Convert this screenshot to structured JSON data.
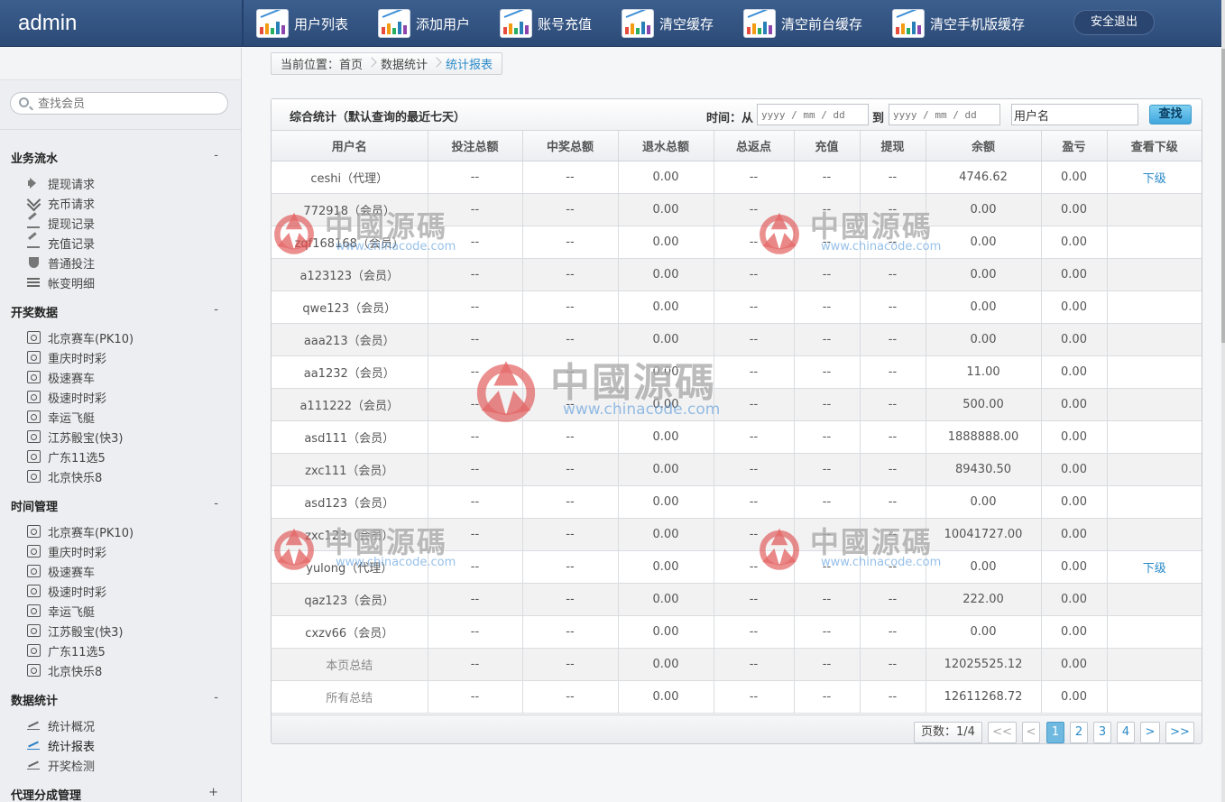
{
  "app": {
    "title": "admin"
  },
  "top_nav": [
    {
      "label": "用户列表",
      "icon": "chart-icon"
    },
    {
      "label": "添加用户",
      "icon": "chart-icon"
    },
    {
      "label": "账号充值",
      "icon": "chart-icon"
    },
    {
      "label": "清空缓存",
      "icon": "chart-icon"
    },
    {
      "label": "清空前台缓存",
      "icon": "chart-icon"
    },
    {
      "label": "清空手机版缓存",
      "icon": "chart-icon"
    }
  ],
  "logout_label": "安全退出",
  "sidebar": {
    "search_placeholder": "查找会员",
    "groups": [
      {
        "title": "业务流水",
        "toggle": "-",
        "items": [
          {
            "label": "提现请求",
            "icon": "speaker-icon"
          },
          {
            "label": "充币请求",
            "icon": "double-chevron-icon"
          },
          {
            "label": "提现记录",
            "icon": "pencil-icon"
          },
          {
            "label": "充值记录",
            "icon": "pencil-icon"
          },
          {
            "label": "普通投注",
            "icon": "shield-icon"
          },
          {
            "label": "帐变明细",
            "icon": "list-icon"
          }
        ]
      },
      {
        "title": "开奖数据",
        "toggle": "-",
        "items": [
          {
            "label": "北京赛车(PK10)",
            "icon": "target-icon"
          },
          {
            "label": "重庆时时彩",
            "icon": "target-icon"
          },
          {
            "label": "极速赛车",
            "icon": "target-icon"
          },
          {
            "label": "极速时时彩",
            "icon": "target-icon"
          },
          {
            "label": "幸运飞艇",
            "icon": "target-icon"
          },
          {
            "label": "江苏骰宝(快3)",
            "icon": "target-icon"
          },
          {
            "label": "广东11选5",
            "icon": "target-icon"
          },
          {
            "label": "北京快乐8",
            "icon": "target-icon"
          }
        ]
      },
      {
        "title": "时间管理",
        "toggle": "-",
        "items": [
          {
            "label": "北京赛车(PK10)",
            "icon": "target-icon"
          },
          {
            "label": "重庆时时彩",
            "icon": "target-icon"
          },
          {
            "label": "极速赛车",
            "icon": "target-icon"
          },
          {
            "label": "极速时时彩",
            "icon": "target-icon"
          },
          {
            "label": "幸运飞艇",
            "icon": "target-icon"
          },
          {
            "label": "江苏骰宝(快3)",
            "icon": "target-icon"
          },
          {
            "label": "广东11选5",
            "icon": "target-icon"
          },
          {
            "label": "北京快乐8",
            "icon": "target-icon"
          }
        ]
      },
      {
        "title": "数据统计",
        "toggle": "-",
        "items": [
          {
            "label": "统计概况",
            "icon": "line-chart-icon"
          },
          {
            "label": "统计报表",
            "icon": "line-chart-icon",
            "active": true
          },
          {
            "label": "开奖检测",
            "icon": "line-chart-icon"
          }
        ]
      },
      {
        "title": "代理分成管理",
        "toggle": "+",
        "items": []
      }
    ]
  },
  "breadcrumb": [
    "当前位置：首页",
    "数据统计",
    "统计报表"
  ],
  "panel": {
    "title": "综合统计（默认查询的最近七天）",
    "time_label": "时间：从",
    "to_label": "到",
    "date_placeholder": "yyyy / mm / dd",
    "date_from": "",
    "date_to": "",
    "username_value": "用户名",
    "search_label": "查找"
  },
  "table": {
    "columns": [
      "用户名",
      "投注总额",
      "中奖总额",
      "退水总额",
      "总返点",
      "充值",
      "提现",
      "余额",
      "盈亏",
      "查看下级"
    ],
    "rows": [
      [
        "ceshi（代理）",
        "--",
        "--",
        "0.00",
        "--",
        "--",
        "--",
        "4746.62",
        "0.00",
        "下级"
      ],
      [
        "772918（会员）",
        "--",
        "--",
        "0.00",
        "--",
        "--",
        "--",
        "0.00",
        "0.00",
        ""
      ],
      [
        "zqf168168（会员）",
        "--",
        "--",
        "0.00",
        "--",
        "--",
        "--",
        "0.00",
        "0.00",
        ""
      ],
      [
        "a123123（会员）",
        "--",
        "--",
        "0.00",
        "--",
        "--",
        "--",
        "0.00",
        "0.00",
        ""
      ],
      [
        "qwe123（会员）",
        "--",
        "--",
        "0.00",
        "--",
        "--",
        "--",
        "0.00",
        "0.00",
        ""
      ],
      [
        "aaa213（会员）",
        "--",
        "--",
        "0.00",
        "--",
        "--",
        "--",
        "0.00",
        "0.00",
        ""
      ],
      [
        "aa1232（会员）",
        "--",
        "--",
        "0.00",
        "--",
        "--",
        "--",
        "11.00",
        "0.00",
        ""
      ],
      [
        "a111222（会员）",
        "--",
        "--",
        "0.00",
        "--",
        "--",
        "--",
        "500.00",
        "0.00",
        ""
      ],
      [
        "asd111（会员）",
        "--",
        "--",
        "0.00",
        "--",
        "--",
        "--",
        "1888888.00",
        "0.00",
        ""
      ],
      [
        "zxc111（会员）",
        "--",
        "--",
        "0.00",
        "--",
        "--",
        "--",
        "89430.50",
        "0.00",
        ""
      ],
      [
        "asd123（会员）",
        "--",
        "--",
        "0.00",
        "--",
        "--",
        "--",
        "0.00",
        "0.00",
        ""
      ],
      [
        "zxc123（会员）",
        "--",
        "--",
        "0.00",
        "--",
        "--",
        "--",
        "10041727.00",
        "0.00",
        ""
      ],
      [
        "yulong（代理）",
        "--",
        "--",
        "0.00",
        "--",
        "--",
        "--",
        "0.00",
        "0.00",
        "下级"
      ],
      [
        "qaz123（会员）",
        "--",
        "--",
        "0.00",
        "--",
        "--",
        "--",
        "222.00",
        "0.00",
        ""
      ],
      [
        "cxzv66（会员）",
        "--",
        "--",
        "0.00",
        "--",
        "--",
        "--",
        "0.00",
        "0.00",
        ""
      ]
    ],
    "totals": [
      [
        "本页总结",
        "--",
        "--",
        "0.00",
        "--",
        "--",
        "--",
        "12025525.12",
        "0.00",
        ""
      ],
      [
        "所有总结",
        "--",
        "--",
        "0.00",
        "--",
        "--",
        "--",
        "12611268.72",
        "0.00",
        ""
      ]
    ]
  },
  "pagination": {
    "info": "页数：1/4",
    "first": "<<",
    "prev": "<",
    "pages": [
      "1",
      "2",
      "3",
      "4"
    ],
    "current": "1",
    "next": ">",
    "last": ">>"
  },
  "watermark": {
    "text": "中國源碼",
    "url": "www.chinacode.com"
  },
  "colors": {
    "header": "#2f4f7e",
    "accent": "#2a8ac8",
    "watermark_emblem": "#e05050"
  }
}
